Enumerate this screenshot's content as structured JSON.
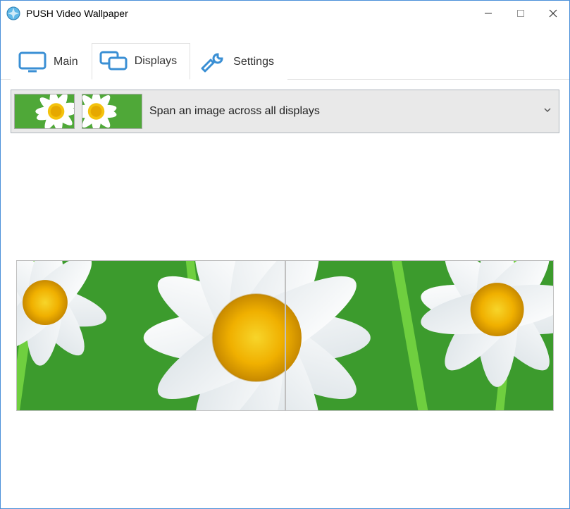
{
  "window": {
    "title": "PUSH Video Wallpaper"
  },
  "tabs": {
    "main": "Main",
    "displays": "Displays",
    "settings": "Settings",
    "active": "displays"
  },
  "dropdown": {
    "label": "Span an image across all displays"
  }
}
